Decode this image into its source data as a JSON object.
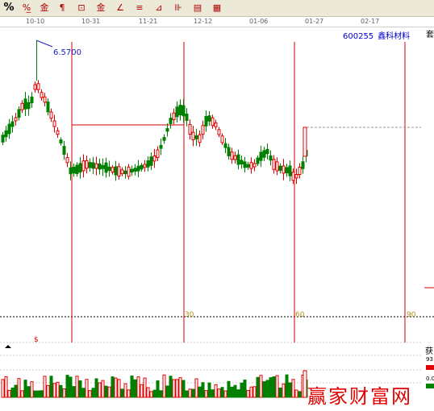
{
  "toolbar": {
    "buttons": [
      {
        "label": "%",
        "icon": "percent-icon"
      },
      {
        "label": "%̲",
        "icon": "percent-underline-icon"
      },
      {
        "label": "金",
        "icon": "gold-icon"
      },
      {
        "label": "¶",
        "icon": "paragraph-icon"
      },
      {
        "label": "⊡",
        "icon": "box-icon"
      },
      {
        "label": "金",
        "icon": "gold-line-icon"
      },
      {
        "label": "∠",
        "icon": "angle-icon"
      },
      {
        "label": "≡",
        "icon": "lines-icon"
      },
      {
        "label": "⊿",
        "icon": "triangle-icon"
      },
      {
        "label": "⊪",
        "icon": "bars-icon"
      },
      {
        "label": "▤",
        "icon": "grid-icon"
      },
      {
        "label": "▦",
        "icon": "table-icon"
      }
    ]
  },
  "date_axis": [
    "10-10",
    "10-31",
    "11-21",
    "12-12",
    "01-06",
    "01-27",
    "02-17"
  ],
  "stock": {
    "code": "600255",
    "name": "鑫科材料"
  },
  "side_tag": "套",
  "peak_label": "6.5700",
  "cycle_labels": [
    "30",
    "60",
    "90"
  ],
  "volume_marker": "$",
  "volume_side": {
    "label": "获",
    "a": "93",
    "b": "0.0"
  },
  "watermark": "赢家财富网",
  "colors": {
    "up": "#e00000",
    "down": "#008000",
    "cycle_line": "#d40000",
    "title": "#0000cc"
  },
  "chart_data": {
    "type": "candlestick",
    "x_ticks": [
      "10-10",
      "10-31",
      "11-21",
      "12-12",
      "01-06",
      "01-27",
      "02-17"
    ],
    "peak_value": 6.57,
    "cycle_markers": [
      "30",
      "60",
      "90"
    ],
    "series": [
      {
        "name": "price"
      },
      {
        "name": "volume"
      }
    ]
  }
}
